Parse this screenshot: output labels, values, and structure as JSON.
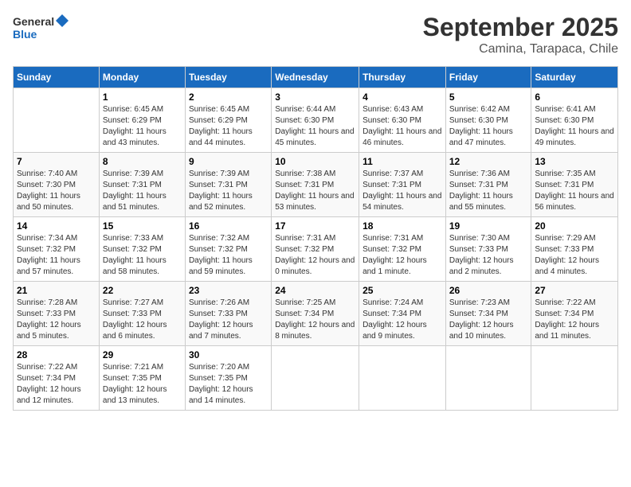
{
  "header": {
    "logo_general": "General",
    "logo_blue": "Blue",
    "month_title": "September 2025",
    "location": "Camina, Tarapaca, Chile"
  },
  "days_of_week": [
    "Sunday",
    "Monday",
    "Tuesday",
    "Wednesday",
    "Thursday",
    "Friday",
    "Saturday"
  ],
  "weeks": [
    [
      {
        "day": "",
        "sunrise": "",
        "sunset": "",
        "daylight": ""
      },
      {
        "day": "1",
        "sunrise": "Sunrise: 6:45 AM",
        "sunset": "Sunset: 6:29 PM",
        "daylight": "Daylight: 11 hours and 43 minutes."
      },
      {
        "day": "2",
        "sunrise": "Sunrise: 6:45 AM",
        "sunset": "Sunset: 6:29 PM",
        "daylight": "Daylight: 11 hours and 44 minutes."
      },
      {
        "day": "3",
        "sunrise": "Sunrise: 6:44 AM",
        "sunset": "Sunset: 6:30 PM",
        "daylight": "Daylight: 11 hours and 45 minutes."
      },
      {
        "day": "4",
        "sunrise": "Sunrise: 6:43 AM",
        "sunset": "Sunset: 6:30 PM",
        "daylight": "Daylight: 11 hours and 46 minutes."
      },
      {
        "day": "5",
        "sunrise": "Sunrise: 6:42 AM",
        "sunset": "Sunset: 6:30 PM",
        "daylight": "Daylight: 11 hours and 47 minutes."
      },
      {
        "day": "6",
        "sunrise": "Sunrise: 6:41 AM",
        "sunset": "Sunset: 6:30 PM",
        "daylight": "Daylight: 11 hours and 49 minutes."
      }
    ],
    [
      {
        "day": "7",
        "sunrise": "Sunrise: 7:40 AM",
        "sunset": "Sunset: 7:30 PM",
        "daylight": "Daylight: 11 hours and 50 minutes."
      },
      {
        "day": "8",
        "sunrise": "Sunrise: 7:39 AM",
        "sunset": "Sunset: 7:31 PM",
        "daylight": "Daylight: 11 hours and 51 minutes."
      },
      {
        "day": "9",
        "sunrise": "Sunrise: 7:39 AM",
        "sunset": "Sunset: 7:31 PM",
        "daylight": "Daylight: 11 hours and 52 minutes."
      },
      {
        "day": "10",
        "sunrise": "Sunrise: 7:38 AM",
        "sunset": "Sunset: 7:31 PM",
        "daylight": "Daylight: 11 hours and 53 minutes."
      },
      {
        "day": "11",
        "sunrise": "Sunrise: 7:37 AM",
        "sunset": "Sunset: 7:31 PM",
        "daylight": "Daylight: 11 hours and 54 minutes."
      },
      {
        "day": "12",
        "sunrise": "Sunrise: 7:36 AM",
        "sunset": "Sunset: 7:31 PM",
        "daylight": "Daylight: 11 hours and 55 minutes."
      },
      {
        "day": "13",
        "sunrise": "Sunrise: 7:35 AM",
        "sunset": "Sunset: 7:31 PM",
        "daylight": "Daylight: 11 hours and 56 minutes."
      }
    ],
    [
      {
        "day": "14",
        "sunrise": "Sunrise: 7:34 AM",
        "sunset": "Sunset: 7:32 PM",
        "daylight": "Daylight: 11 hours and 57 minutes."
      },
      {
        "day": "15",
        "sunrise": "Sunrise: 7:33 AM",
        "sunset": "Sunset: 7:32 PM",
        "daylight": "Daylight: 11 hours and 58 minutes."
      },
      {
        "day": "16",
        "sunrise": "Sunrise: 7:32 AM",
        "sunset": "Sunset: 7:32 PM",
        "daylight": "Daylight: 11 hours and 59 minutes."
      },
      {
        "day": "17",
        "sunrise": "Sunrise: 7:31 AM",
        "sunset": "Sunset: 7:32 PM",
        "daylight": "Daylight: 12 hours and 0 minutes."
      },
      {
        "day": "18",
        "sunrise": "Sunrise: 7:31 AM",
        "sunset": "Sunset: 7:32 PM",
        "daylight": "Daylight: 12 hours and 1 minute."
      },
      {
        "day": "19",
        "sunrise": "Sunrise: 7:30 AM",
        "sunset": "Sunset: 7:33 PM",
        "daylight": "Daylight: 12 hours and 2 minutes."
      },
      {
        "day": "20",
        "sunrise": "Sunrise: 7:29 AM",
        "sunset": "Sunset: 7:33 PM",
        "daylight": "Daylight: 12 hours and 4 minutes."
      }
    ],
    [
      {
        "day": "21",
        "sunrise": "Sunrise: 7:28 AM",
        "sunset": "Sunset: 7:33 PM",
        "daylight": "Daylight: 12 hours and 5 minutes."
      },
      {
        "day": "22",
        "sunrise": "Sunrise: 7:27 AM",
        "sunset": "Sunset: 7:33 PM",
        "daylight": "Daylight: 12 hours and 6 minutes."
      },
      {
        "day": "23",
        "sunrise": "Sunrise: 7:26 AM",
        "sunset": "Sunset: 7:33 PM",
        "daylight": "Daylight: 12 hours and 7 minutes."
      },
      {
        "day": "24",
        "sunrise": "Sunrise: 7:25 AM",
        "sunset": "Sunset: 7:34 PM",
        "daylight": "Daylight: 12 hours and 8 minutes."
      },
      {
        "day": "25",
        "sunrise": "Sunrise: 7:24 AM",
        "sunset": "Sunset: 7:34 PM",
        "daylight": "Daylight: 12 hours and 9 minutes."
      },
      {
        "day": "26",
        "sunrise": "Sunrise: 7:23 AM",
        "sunset": "Sunset: 7:34 PM",
        "daylight": "Daylight: 12 hours and 10 minutes."
      },
      {
        "day": "27",
        "sunrise": "Sunrise: 7:22 AM",
        "sunset": "Sunset: 7:34 PM",
        "daylight": "Daylight: 12 hours and 11 minutes."
      }
    ],
    [
      {
        "day": "28",
        "sunrise": "Sunrise: 7:22 AM",
        "sunset": "Sunset: 7:34 PM",
        "daylight": "Daylight: 12 hours and 12 minutes."
      },
      {
        "day": "29",
        "sunrise": "Sunrise: 7:21 AM",
        "sunset": "Sunset: 7:35 PM",
        "daylight": "Daylight: 12 hours and 13 minutes."
      },
      {
        "day": "30",
        "sunrise": "Sunrise: 7:20 AM",
        "sunset": "Sunset: 7:35 PM",
        "daylight": "Daylight: 12 hours and 14 minutes."
      },
      {
        "day": "",
        "sunrise": "",
        "sunset": "",
        "daylight": ""
      },
      {
        "day": "",
        "sunrise": "",
        "sunset": "",
        "daylight": ""
      },
      {
        "day": "",
        "sunrise": "",
        "sunset": "",
        "daylight": ""
      },
      {
        "day": "",
        "sunrise": "",
        "sunset": "",
        "daylight": ""
      }
    ]
  ]
}
